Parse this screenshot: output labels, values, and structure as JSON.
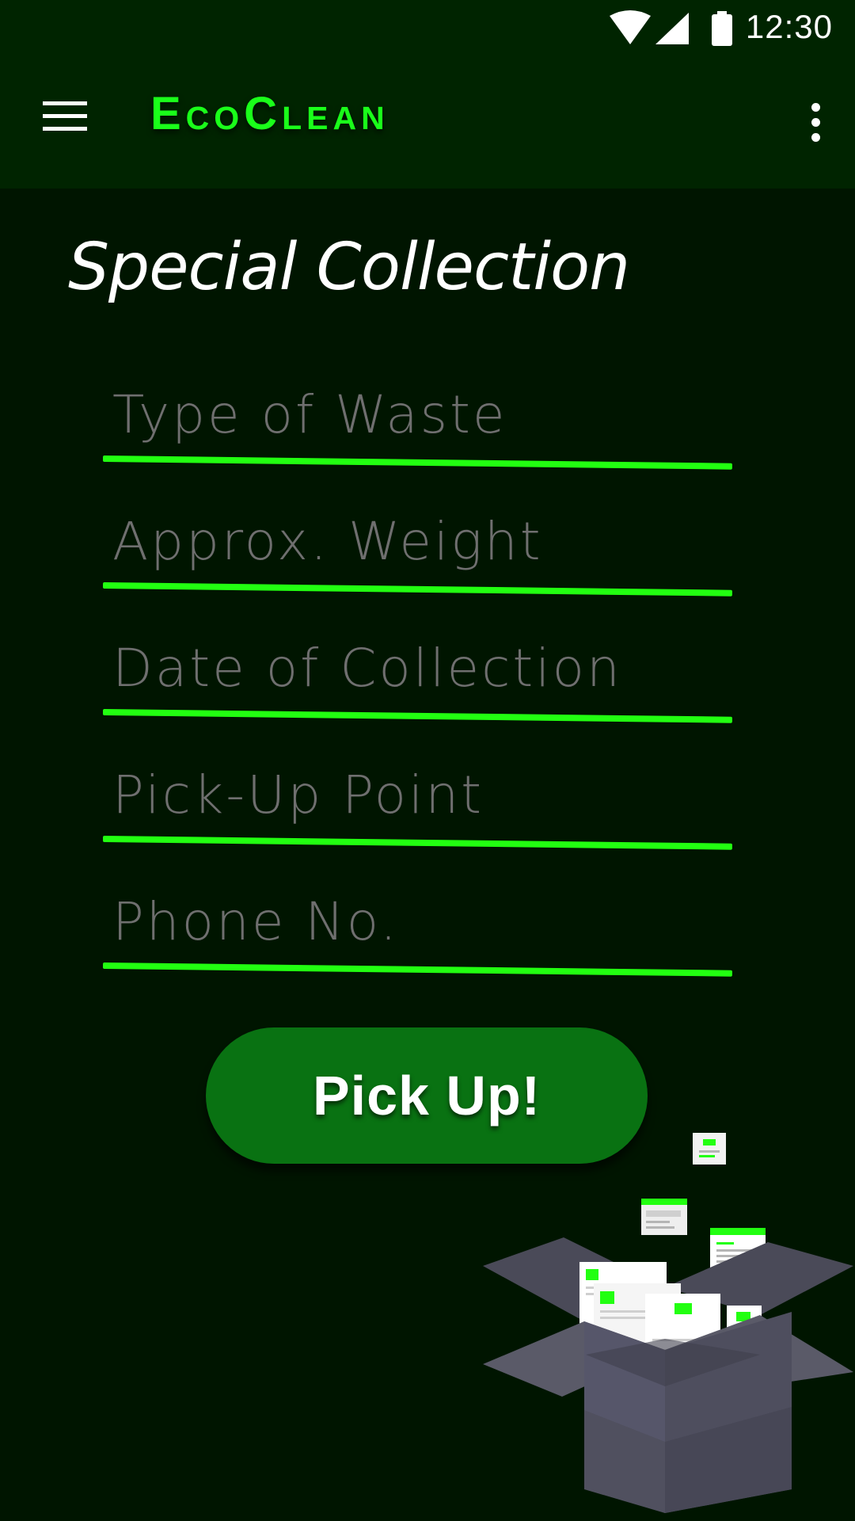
{
  "status_bar": {
    "time": "12:30",
    "icons": [
      "wifi-icon",
      "cellular-signal-icon",
      "battery-icon"
    ]
  },
  "app_bar": {
    "title": "EcoClean",
    "menu_icon": "hamburger-menu-icon",
    "overflow_icon": "more-vertical-icon"
  },
  "page": {
    "title": "Special Collection"
  },
  "form": {
    "fields": [
      {
        "placeholder": "Type of Waste",
        "value": ""
      },
      {
        "placeholder": "Approx. Weight",
        "value": ""
      },
      {
        "placeholder": "Date of Collection",
        "value": ""
      },
      {
        "placeholder": "Pick-Up Point",
        "value": ""
      },
      {
        "placeholder": "Phone No.",
        "value": ""
      }
    ],
    "submit_label": "Pick Up!"
  },
  "illustration": "open-box-with-documents-illustration",
  "colors": {
    "background": "#001500",
    "app_bar": "#002400",
    "accent": "#22ff11",
    "button": "#097212",
    "title_text": "#1aff1a"
  }
}
